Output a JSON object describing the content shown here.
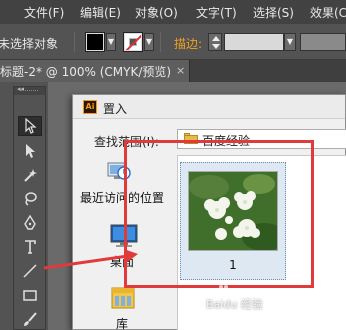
{
  "menubar": {
    "items": [
      "文件(F)",
      "编辑(E)",
      "对象(O)",
      "文字(T)",
      "选择(S)",
      "效果(C"
    ]
  },
  "controlbar": {
    "selection_label": "未选择对象",
    "stroke_label": "描边:"
  },
  "tab": {
    "title": "标题-2* @ 100% (CMYK/预览)",
    "close": "×"
  },
  "dialog": {
    "title": "置入",
    "app_icon_text": "Ai",
    "look_in_label": "查找范围(I):",
    "look_in_value": "百度经验",
    "places": [
      {
        "label": "最近访问的位置"
      },
      {
        "label": "桌面"
      },
      {
        "label": "库"
      }
    ],
    "files": [
      {
        "name": "1"
      }
    ]
  },
  "watermark": {
    "text": "Baidu 经验"
  },
  "colors": {
    "annotation_red": "#e03a3a",
    "stroke_label_orange": "#f0a020"
  }
}
